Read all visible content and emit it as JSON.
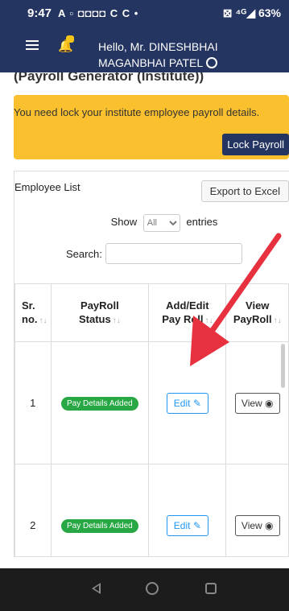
{
  "status_bar": {
    "time": "9:47",
    "icons": "A ▫ ◘◘◘◘ C C •",
    "battery": "⊠ ⁴ᴳ◢ 63%"
  },
  "header": {
    "greeting_line1": "Hello, Mr. DINESHBHAI",
    "greeting_line2": "MAGANBHAI PATEL"
  },
  "page": {
    "title": "(Payroll Generator (Institute))"
  },
  "alert": {
    "message": "You need lock your institute employee payroll details.",
    "button": "Lock Payroll",
    "color": "#fbc02d"
  },
  "employee_list": {
    "title": "Employee List",
    "export_button": "Export to Excel",
    "show_label": "Show",
    "entries_value": "All",
    "entries_label": "entries",
    "search_label": "Search:",
    "columns": [
      {
        "line1": "Sr.",
        "line2": "no."
      },
      {
        "line1": "PayRoll",
        "line2": "Status"
      },
      {
        "line1": "Add/Edit",
        "line2": "Pay Roll"
      },
      {
        "line1": "View",
        "line2": "PayRoll"
      }
    ],
    "rows": [
      {
        "sr": "1",
        "status": "Pay Details Added",
        "edit": "Edit",
        "view": "View"
      },
      {
        "sr": "2",
        "status": "Pay Details Added",
        "edit": "Edit",
        "view": "View"
      }
    ]
  },
  "colors": {
    "navy": "#253561",
    "arrow": "#e8313f",
    "badge": "#28a745",
    "edit": "#2196f3"
  }
}
